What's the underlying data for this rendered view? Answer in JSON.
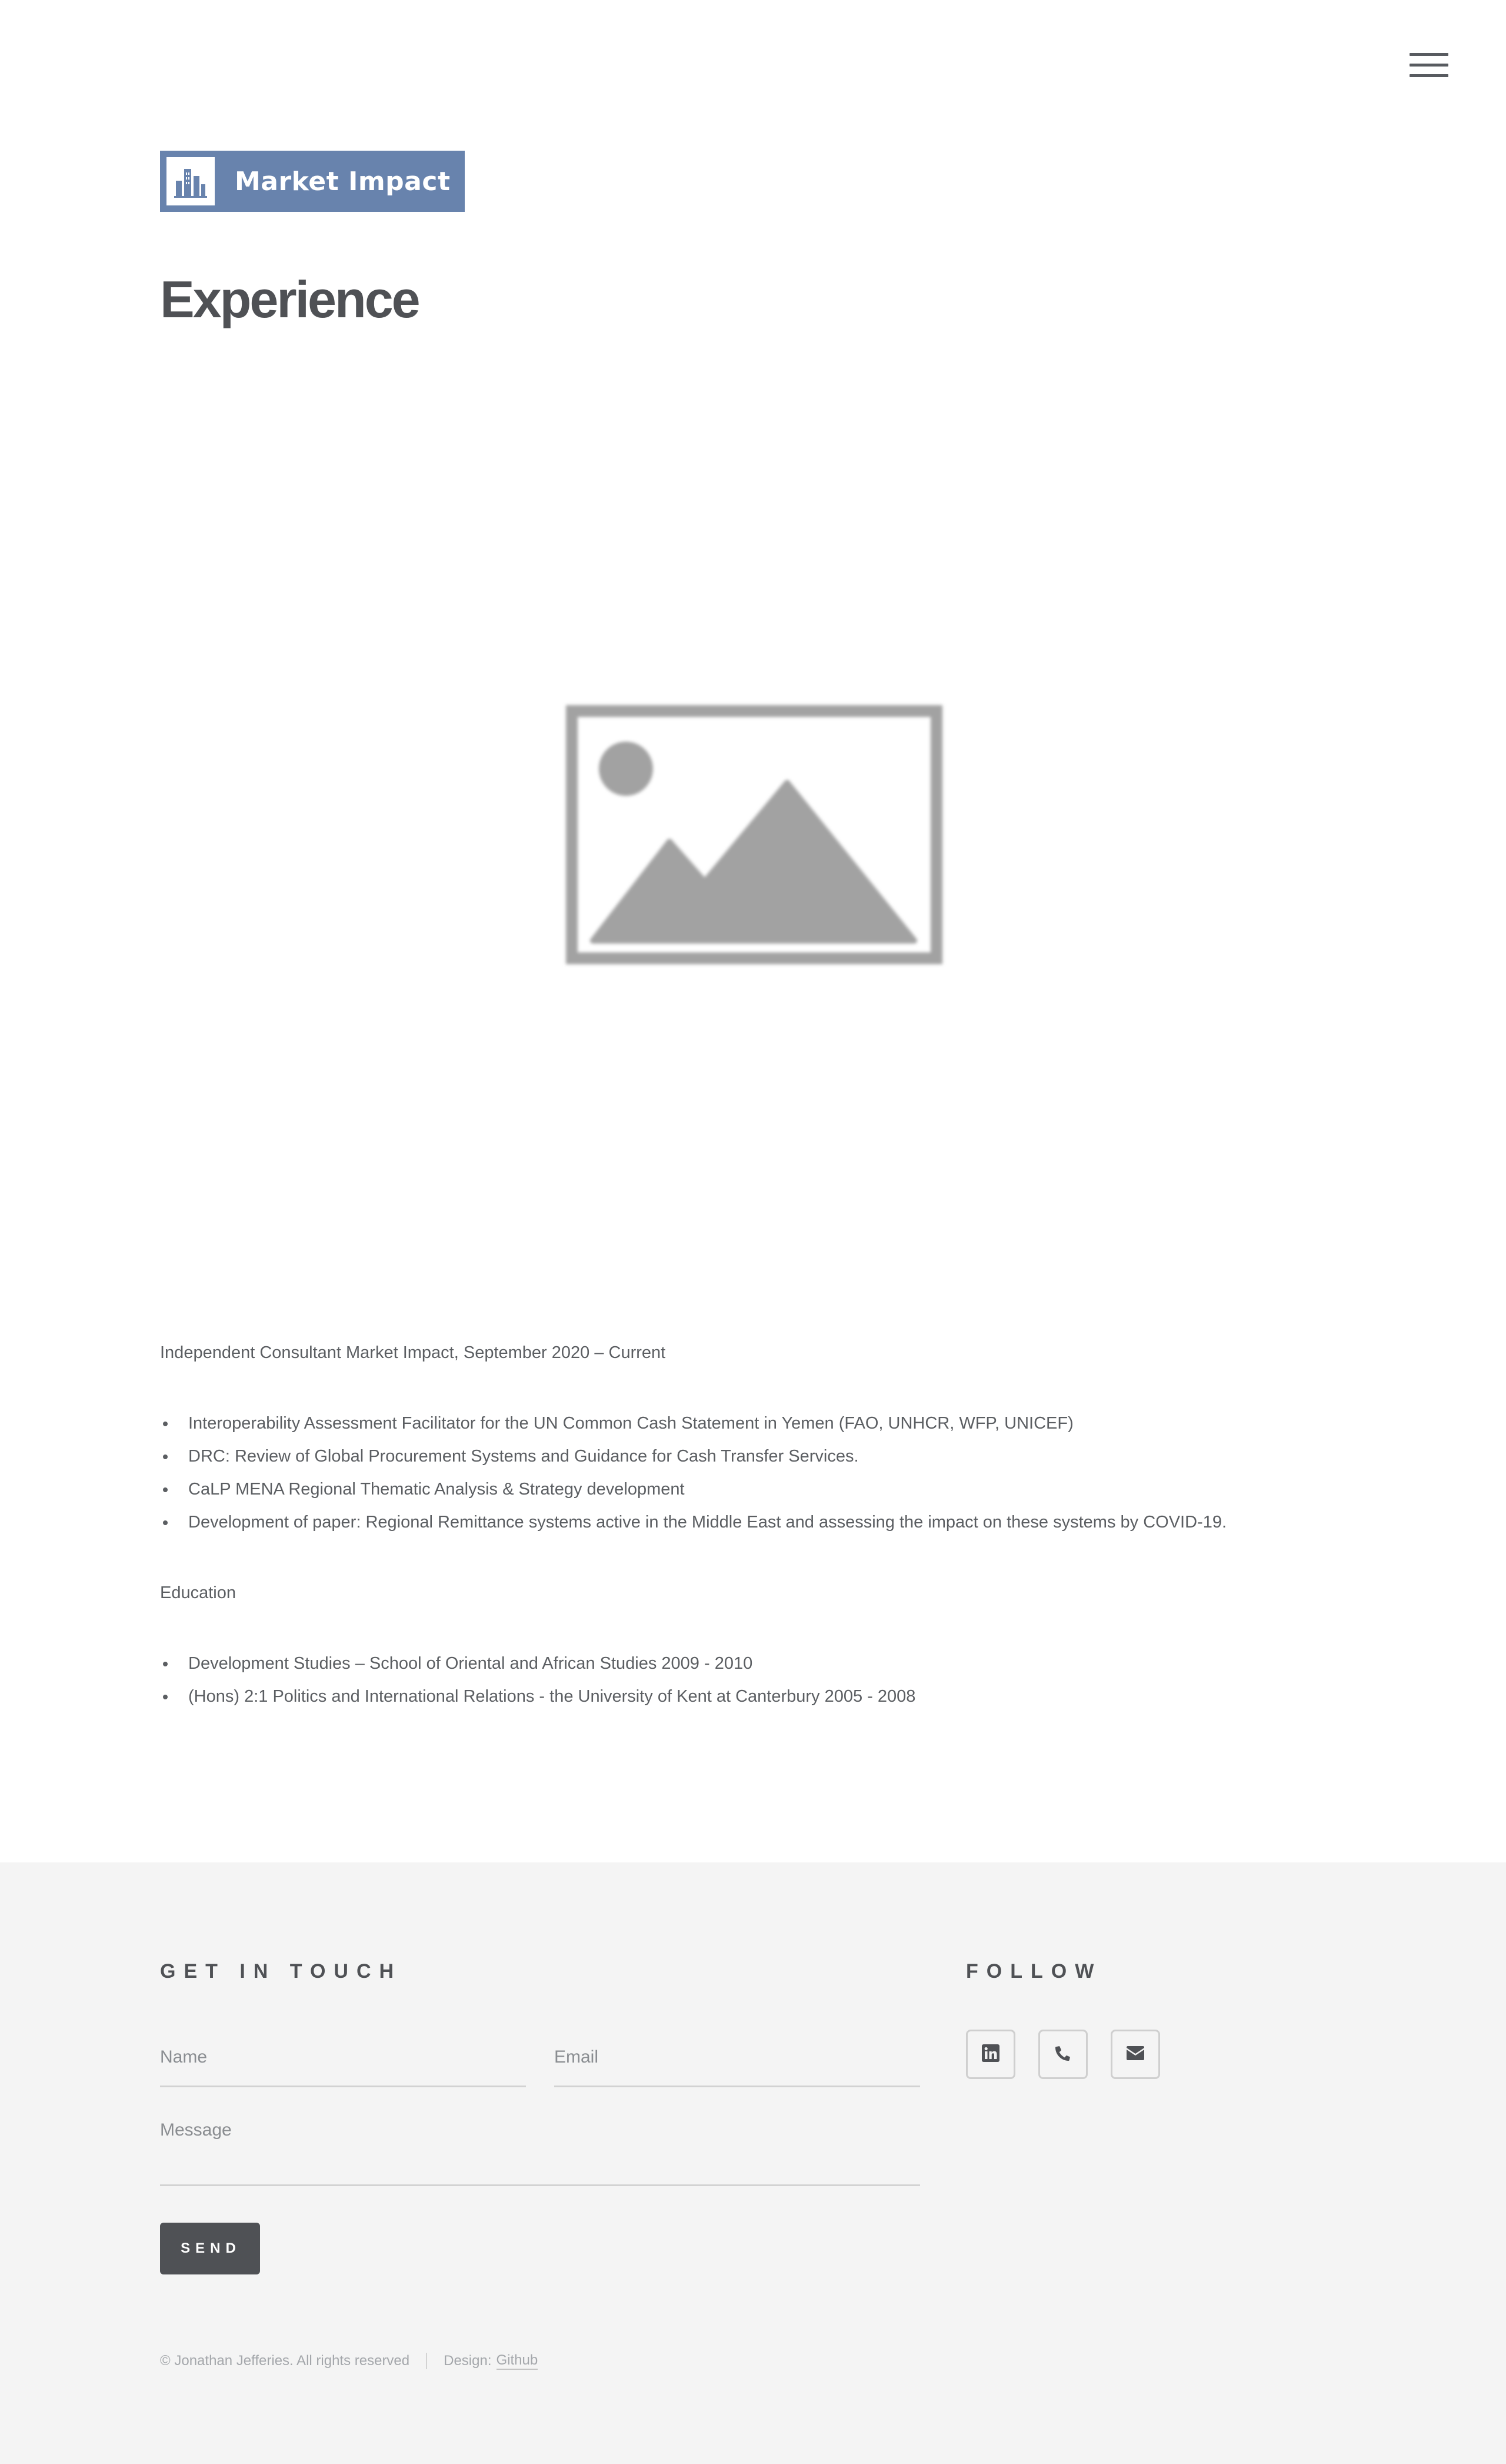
{
  "header": {
    "menu_icon": "hamburger-menu-icon",
    "logo_text": "Market Impact",
    "logo_icon": "bar-chart-buildings-icon",
    "logo_color": "#6883ad"
  },
  "page": {
    "title": "Experience",
    "image_icon": "image-placeholder-icon"
  },
  "experience": {
    "role": "Independent Consultant Market Impact, September 2020 – Current",
    "items": [
      "Interoperability Assessment Facilitator for the UN Common Cash Statement in Yemen (FAO, UNHCR, WFP, UNICEF)",
      "DRC: Review of Global Procurement Systems and Guidance for Cash Transfer Services.",
      "CaLP MENA Regional Thematic Analysis & Strategy development",
      "Development of paper: Regional Remittance systems active in the Middle East and assessing the impact on these systems by COVID-19."
    ]
  },
  "education": {
    "heading": "Education",
    "items": [
      "Development Studies – School of Oriental and African Studies 2009 - 2010",
      "(Hons) 2:1 Politics and International Relations - the University of Kent at Canterbury 2005 - 2008"
    ]
  },
  "footer": {
    "contact_heading": "GET IN TOUCH",
    "name_placeholder": "Name",
    "email_placeholder": "Email",
    "message_placeholder": "Message",
    "send_label": "SEND",
    "follow_heading": "FOLLOW",
    "social": [
      {
        "name": "linkedin",
        "icon": "linkedin-icon"
      },
      {
        "name": "phone",
        "icon": "phone-icon"
      },
      {
        "name": "email",
        "icon": "envelope-icon"
      }
    ],
    "copyright": "© Jonathan Jefferies. All rights reserved",
    "design_label": "Design:",
    "design_link": "Github",
    "background": "#f4f4f4",
    "button_color": "#4f5155"
  }
}
